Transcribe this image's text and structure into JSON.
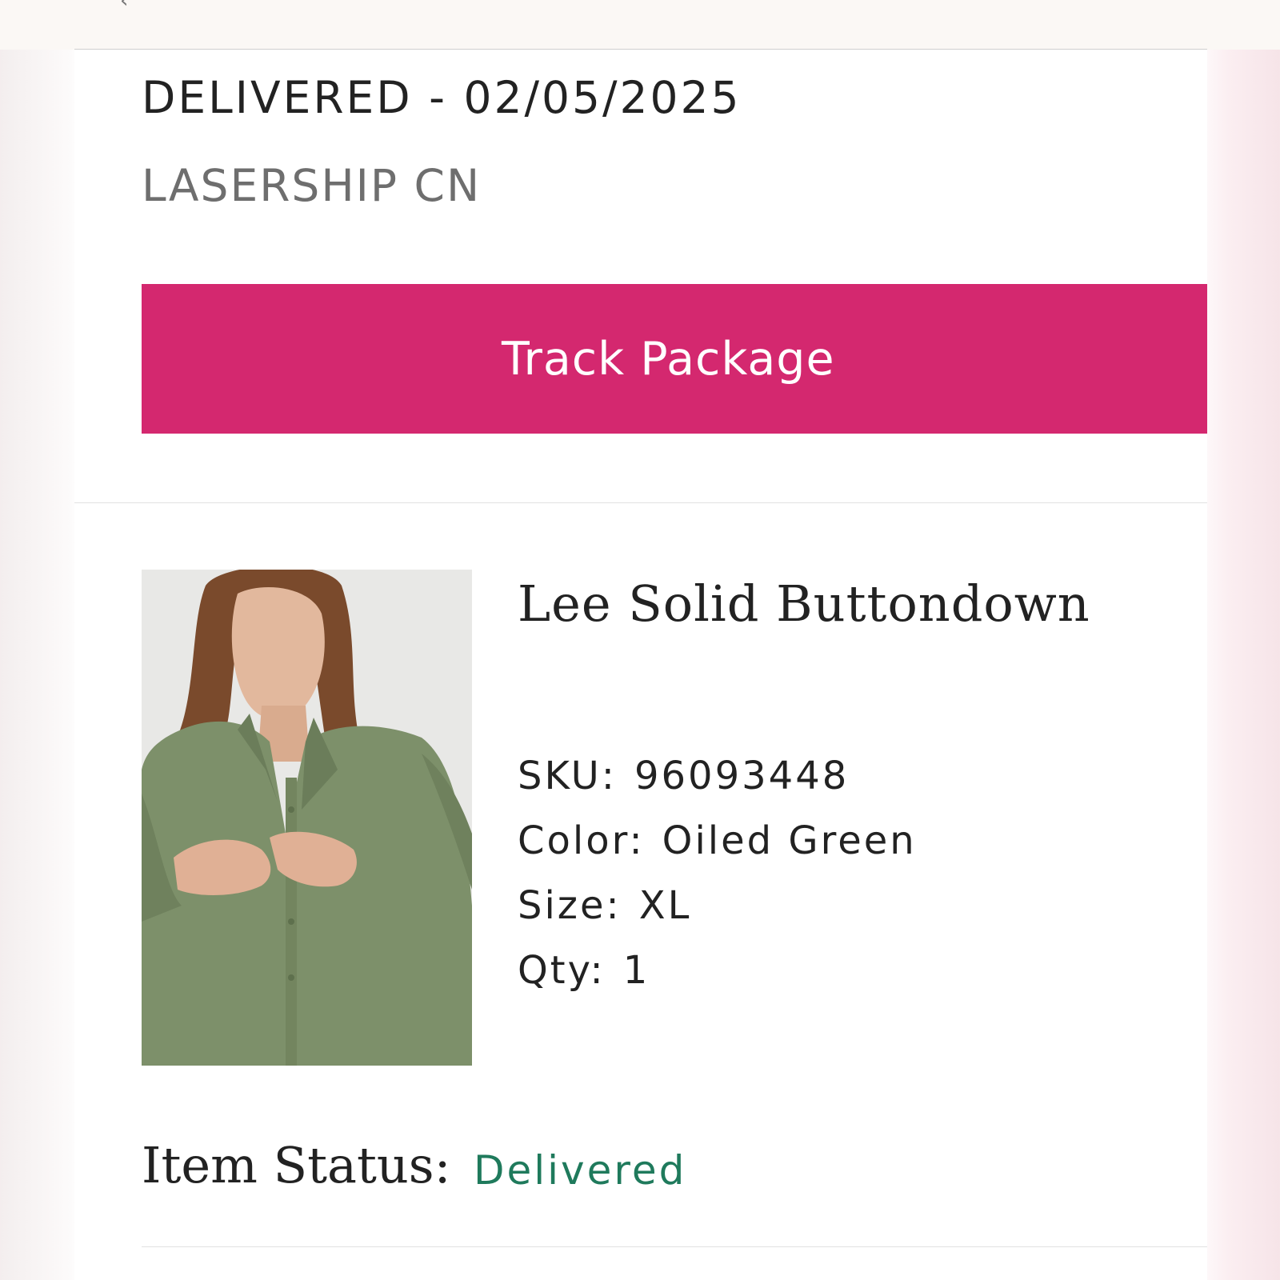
{
  "shipment": {
    "status_line": "DELIVERED - 02/05/2025",
    "carrier": "LASERSHIP CN",
    "track_button_label": "Track Package"
  },
  "item": {
    "name": "Lee Solid Buttondown",
    "image_alt": "Model wearing oiled green button-down shirt",
    "sku_label": "SKU:",
    "sku_value": "96093448",
    "color_label": "Color:",
    "color_value": "Oiled Green",
    "size_label": "Size:",
    "size_value": "XL",
    "qty_label": "Qty:",
    "qty_value": "1",
    "status_label": "Item Status:",
    "status_value": "Delivered"
  },
  "colors": {
    "accent": "#d4286f",
    "status_delivered": "#1f7a5c",
    "text_primary": "#222222",
    "text_secondary": "#6e6e6e"
  },
  "icons": {
    "back": "chevron-left-icon"
  }
}
